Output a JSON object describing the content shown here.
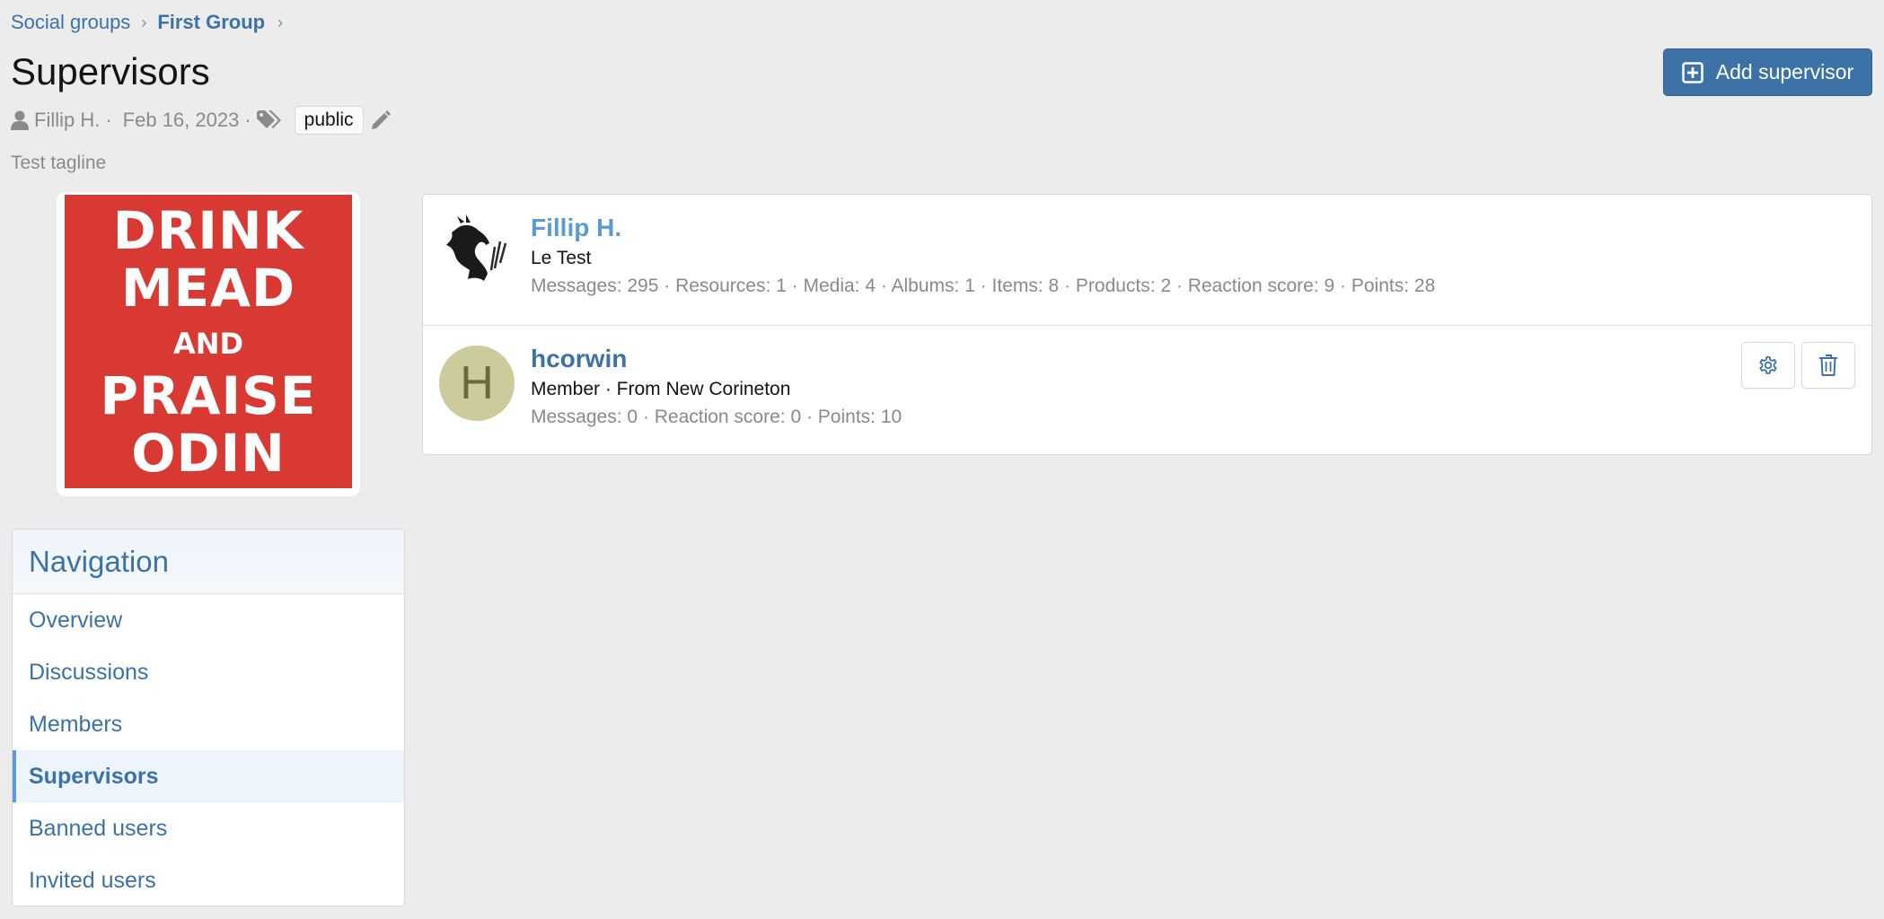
{
  "breadcrumb": [
    {
      "label": "Social groups"
    },
    {
      "label": "First Group"
    }
  ],
  "page": {
    "title": "Supervisors",
    "author": "Fillip H.",
    "date": "Feb 16, 2023",
    "tag": "public",
    "tagline": "Test tagline",
    "meta_sep": "·"
  },
  "actions": {
    "add_supervisor": "Add supervisor"
  },
  "group_image": {
    "lines": [
      "DRINK",
      "MEAD",
      "AND",
      "PRAISE",
      "ODIN"
    ]
  },
  "navigation": {
    "title": "Navigation",
    "items": [
      {
        "label": "Overview",
        "active": false
      },
      {
        "label": "Discussions",
        "active": false
      },
      {
        "label": "Members",
        "active": false
      },
      {
        "label": "Supervisors",
        "active": true
      },
      {
        "label": "Banned users",
        "active": false
      },
      {
        "label": "Invited users",
        "active": false
      }
    ]
  },
  "supervisors": [
    {
      "name": "Fillip H.",
      "avatar": "dragon-image",
      "title": "Le Test",
      "stats": "Messages: 295 · Resources: 1 · Media: 4 · Albums: 1 · Items: 8 · Products: 2 · Reaction score: 9 · Points: 28"
    },
    {
      "name": "hcorwin",
      "avatar_letter": "H",
      "title": "Member · From New Corineton",
      "stats": "Messages: 0 · Reaction score: 0 · Points: 10"
    }
  ],
  "colors": {
    "accent": "#3d72a7",
    "background": "#ececec",
    "poster_red": "#d83a33",
    "avatar_bg": "#cbcb9c"
  }
}
